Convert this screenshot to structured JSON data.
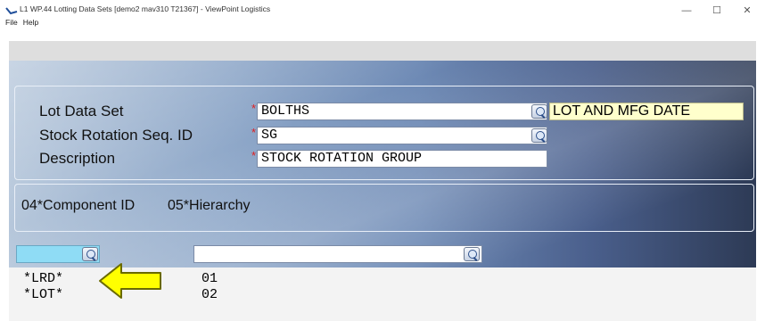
{
  "window": {
    "title": "L1 WP.44 Lotting Data Sets [demo2 mav310 T21367] - ViewPoint Logistics",
    "minimize_glyph": "—",
    "maximize_glyph": "☐",
    "close_glyph": "✕"
  },
  "menu": {
    "file": "File",
    "help": "Help"
  },
  "form": {
    "lot_data_set": {
      "label": "Lot Data Set",
      "value": "BOLTHS",
      "description": "LOT AND MFG DATE"
    },
    "stock_rotation": {
      "label": "Stock Rotation Seq. ID",
      "value": "SG"
    },
    "description": {
      "label": "Description",
      "value": "STOCK ROTATION GROUP"
    },
    "required_marker": "*"
  },
  "columns": {
    "component_id": "04*Component ID",
    "hierarchy": "05*Hierarchy"
  },
  "filters": {
    "component_value": "",
    "hierarchy_value": ""
  },
  "rows": [
    {
      "component": "*LRD*",
      "hierarchy": "01"
    },
    {
      "component": "*LOT*",
      "hierarchy": "02"
    }
  ],
  "colors": {
    "highlight_field": "#8fdcf5",
    "description_display": "#ffffcc",
    "arrow": "#ffff00",
    "required": "#e02020"
  },
  "icons": {
    "lookup": "magnifier-icon",
    "arrow": "left-arrow-icon"
  }
}
